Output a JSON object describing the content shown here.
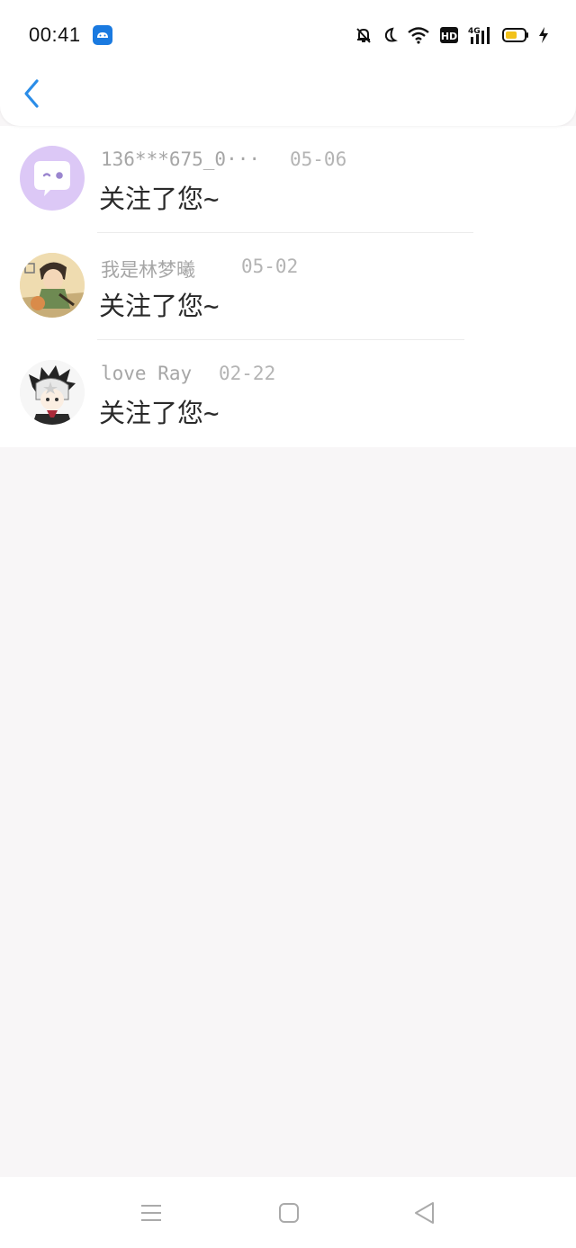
{
  "status_bar": {
    "time": "00:41",
    "icons": [
      "android-app-icon",
      "mute-bell-icon",
      "moon-icon",
      "wifi-icon",
      "hd-icon",
      "signal-4g-icon",
      "battery-icon",
      "charging-icon"
    ],
    "hd_label": "HD",
    "network_label": "4G"
  },
  "header": {
    "back_icon": "chevron-left-icon",
    "accent": "#2b8de8"
  },
  "notifications": [
    {
      "name": "136***675_0···",
      "date": "05-06",
      "message": "关注了您~",
      "avatar": "chat-bubble-avatar"
    },
    {
      "name": "我是林梦曦",
      "date": "05-02",
      "message": "关注了您~",
      "avatar": "anime-character-avatar"
    },
    {
      "name": "love Ray",
      "date": "02-22",
      "message": "关注了您~",
      "avatar": "anime-boy-avatar"
    }
  ],
  "nav_bar": {
    "icons": [
      "menu-icon",
      "home-square-icon",
      "back-triangle-icon"
    ]
  }
}
